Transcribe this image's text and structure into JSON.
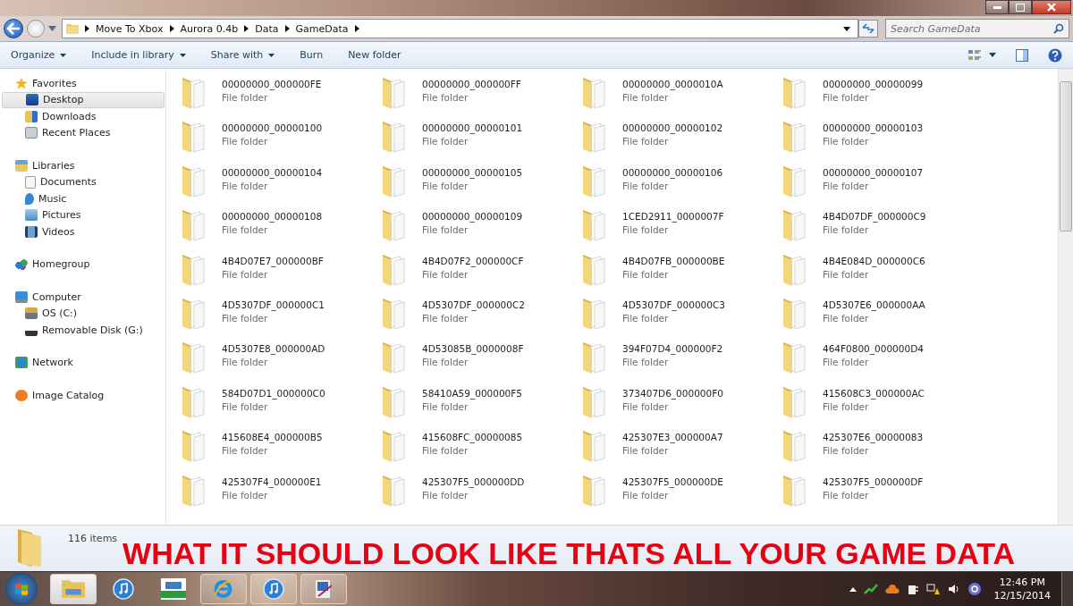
{
  "address": {
    "crumbs": [
      "Move To Xbox",
      "Aurora 0.4b",
      "Data",
      "GameData"
    ]
  },
  "search": {
    "placeholder": "Search GameData"
  },
  "toolbar": [
    {
      "label": "Organize",
      "dropdown": true
    },
    {
      "label": "Include in library",
      "dropdown": true
    },
    {
      "label": "Share with",
      "dropdown": true
    },
    {
      "label": "Burn",
      "dropdown": false
    },
    {
      "label": "New folder",
      "dropdown": false
    }
  ],
  "sidebar": [
    {
      "label": "Favorites",
      "children": [
        {
          "label": "Desktop",
          "selected": true
        },
        {
          "label": "Downloads",
          "selected": false
        },
        {
          "label": "Recent Places",
          "selected": false
        }
      ]
    },
    {
      "label": "Libraries",
      "children": [
        {
          "label": "Documents",
          "selected": false
        },
        {
          "label": "Music",
          "selected": false
        },
        {
          "label": "Pictures",
          "selected": false
        },
        {
          "label": "Videos",
          "selected": false
        }
      ]
    },
    {
      "label": "Homegroup"
    },
    {
      "label": "Computer",
      "children": [
        {
          "label": "OS (C:)",
          "selected": false
        },
        {
          "label": "Removable Disk (G:)",
          "selected": false
        }
      ]
    },
    {
      "label": "Network"
    },
    {
      "label": "Image Catalog"
    }
  ],
  "folders": [
    {
      "name": "00000000_000000FE",
      "type": "File folder"
    },
    {
      "name": "00000000_000000FF",
      "type": "File folder"
    },
    {
      "name": "00000000_0000010A",
      "type": "File folder"
    },
    {
      "name": "00000000_00000099",
      "type": "File folder"
    },
    {
      "name": "00000000_00000100",
      "type": "File folder"
    },
    {
      "name": "00000000_00000101",
      "type": "File folder"
    },
    {
      "name": "00000000_00000102",
      "type": "File folder"
    },
    {
      "name": "00000000_00000103",
      "type": "File folder"
    },
    {
      "name": "00000000_00000104",
      "type": "File folder"
    },
    {
      "name": "00000000_00000105",
      "type": "File folder"
    },
    {
      "name": "00000000_00000106",
      "type": "File folder"
    },
    {
      "name": "00000000_00000107",
      "type": "File folder"
    },
    {
      "name": "00000000_00000108",
      "type": "File folder"
    },
    {
      "name": "00000000_00000109",
      "type": "File folder"
    },
    {
      "name": "1CED2911_0000007F",
      "type": "File folder"
    },
    {
      "name": "4B4D07DF_000000C9",
      "type": "File folder"
    },
    {
      "name": "4B4D07E7_000000BF",
      "type": "File folder"
    },
    {
      "name": "4B4D07F2_000000CF",
      "type": "File folder"
    },
    {
      "name": "4B4D07FB_000000BE",
      "type": "File folder"
    },
    {
      "name": "4B4E084D_000000C6",
      "type": "File folder"
    },
    {
      "name": "4D5307DF_000000C1",
      "type": "File folder"
    },
    {
      "name": "4D5307DF_000000C2",
      "type": "File folder"
    },
    {
      "name": "4D5307DF_000000C3",
      "type": "File folder"
    },
    {
      "name": "4D5307E6_000000AA",
      "type": "File folder"
    },
    {
      "name": "4D5307E8_000000AD",
      "type": "File folder"
    },
    {
      "name": "4D53085B_0000008F",
      "type": "File folder"
    },
    {
      "name": "394F07D4_000000F2",
      "type": "File folder"
    },
    {
      "name": "464F0800_000000D4",
      "type": "File folder"
    },
    {
      "name": "584D07D1_000000C0",
      "type": "File folder"
    },
    {
      "name": "58410A59_000000F5",
      "type": "File folder"
    },
    {
      "name": "373407D6_000000F0",
      "type": "File folder"
    },
    {
      "name": "415608C3_000000AC",
      "type": "File folder"
    },
    {
      "name": "415608E4_000000B5",
      "type": "File folder"
    },
    {
      "name": "415608FC_00000085",
      "type": "File folder"
    },
    {
      "name": "425307E3_000000A7",
      "type": "File folder"
    },
    {
      "name": "425307E6_00000083",
      "type": "File folder"
    },
    {
      "name": "425307F4_000000E1",
      "type": "File folder"
    },
    {
      "name": "425307F5_000000DD",
      "type": "File folder"
    },
    {
      "name": "425307F5_000000DE",
      "type": "File folder"
    },
    {
      "name": "425307F5_000000DF",
      "type": "File folder"
    }
  ],
  "status_bar": {
    "count": "116 items",
    "caption": "WHAT IT SHOULD LOOK LIKE  THATS ALL YOUR GAME DATA"
  },
  "taskbar": {
    "apps": [
      {
        "kind": "explorer",
        "open": true
      },
      {
        "kind": "itunes",
        "open": false
      },
      {
        "kind": "ftp",
        "open": false
      },
      {
        "kind": "ie",
        "open": true
      },
      {
        "kind": "itunes",
        "open": true
      },
      {
        "kind": "editor",
        "open": true
      }
    ],
    "clock": {
      "time": "12:46 PM",
      "date": "12/15/2014"
    }
  }
}
